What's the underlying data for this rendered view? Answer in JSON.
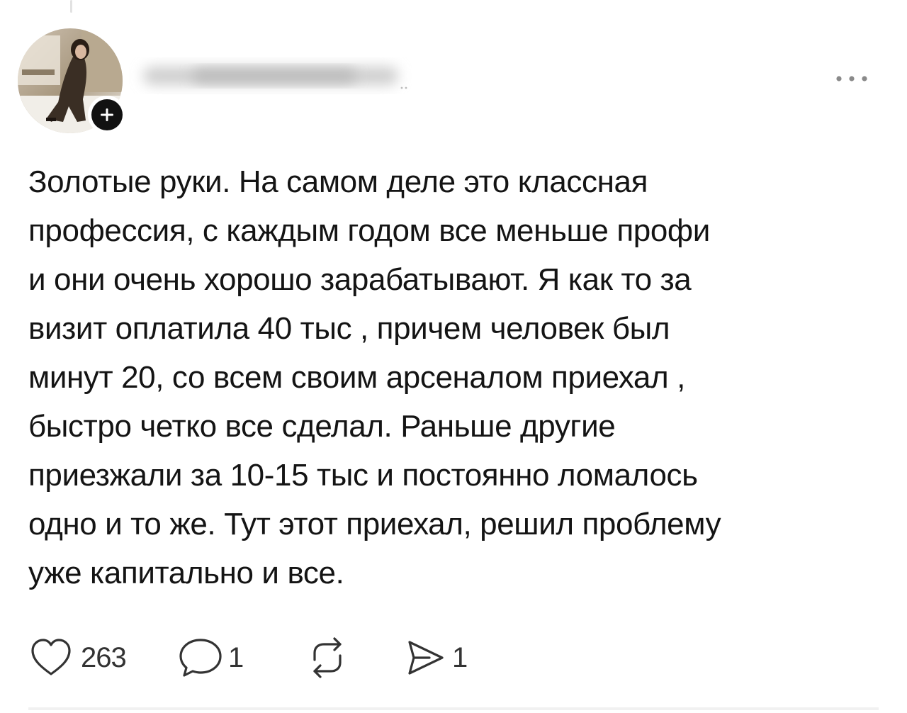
{
  "post": {
    "author": {
      "username": "",
      "avatar_icon": "profile-photo",
      "follow_icon": "plus-icon"
    },
    "menu_icon": "more-horizontal-icon",
    "lines": [
      "Золотые руки. На самом деле это классная",
      "профессия, с каждым годом все меньше профи",
      "и они очень хорошо зарабатывают. Я как то за",
      "визит оплатила 40 тыс , причем человек был",
      "минут 20, со всем своим арсеналом приехал ,",
      "быстро четко все сделал. Раньше другие",
      "приезжали за 10-15 тыс и постоянно ломалось",
      "одно и то же. Тут этот приехал, решил проблему",
      "уже капитально и все."
    ]
  },
  "actions": {
    "like": {
      "icon": "heart-icon",
      "count": "263"
    },
    "reply": {
      "icon": "speech-bubble-icon",
      "count": "1"
    },
    "repost": {
      "icon": "repost-icon",
      "count": ""
    },
    "share": {
      "icon": "send-icon",
      "count": "1"
    }
  },
  "colors": {
    "text": "#141414",
    "icon": "#333333",
    "badge": "#111111",
    "background": "#ffffff"
  }
}
